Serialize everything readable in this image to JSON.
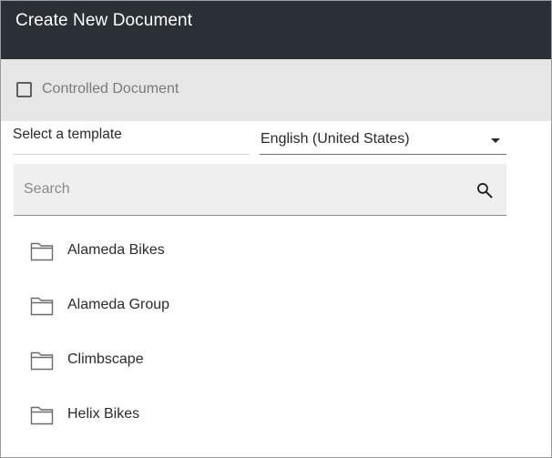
{
  "dialog": {
    "title": "Create New Document"
  },
  "controlled": {
    "label": "Controlled Document",
    "checked": false
  },
  "template": {
    "label": "Select a template"
  },
  "language": {
    "selected": "English (United States)"
  },
  "search": {
    "placeholder": "Search",
    "value": "",
    "icon": "search-icon"
  },
  "folders": [
    {
      "name": "Alameda Bikes",
      "icon": "folder-icon"
    },
    {
      "name": "Alameda Group",
      "icon": "folder-icon"
    },
    {
      "name": "Climbscape",
      "icon": "folder-icon"
    },
    {
      "name": "Helix Bikes",
      "icon": "folder-icon"
    }
  ],
  "colors": {
    "titlebar": "#2a3035",
    "controlled_row": "#e6e6e6",
    "search_background": "#efefef"
  }
}
